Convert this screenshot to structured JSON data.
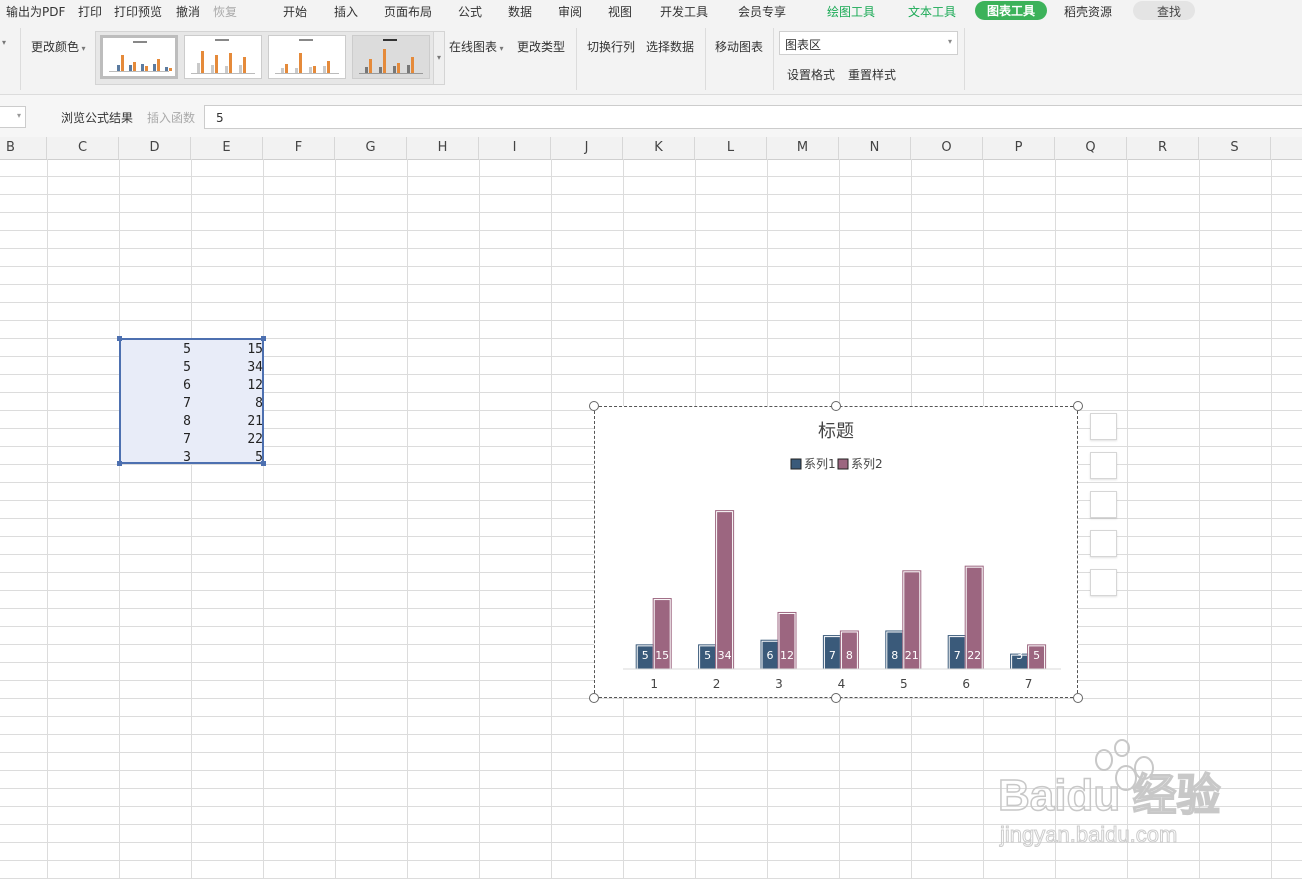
{
  "menu": {
    "items": [
      "输出为PDF",
      "打印",
      "打印预览",
      "撤消",
      "恢复",
      "开始",
      "插入",
      "页面布局",
      "公式",
      "数据",
      "审阅",
      "视图",
      "开发工具",
      "会员专享",
      "绘图工具",
      "文本工具",
      "图表工具",
      "稻壳资源"
    ],
    "search_label": "查找"
  },
  "ribbon": {
    "change_color": "更改颜色",
    "online_chart": "在线图表",
    "change_type": "更改类型",
    "switch_row_col": "切换行列",
    "select_data": "选择数据",
    "move_chart": "移动图表",
    "chart_area_select": "图表区",
    "set_format": "设置格式",
    "reset_style": "重置样式"
  },
  "formula_bar": {
    "browse_result": "浏览公式结果",
    "insert_function": "插入函数",
    "value": "5"
  },
  "columns": [
    "B",
    "C",
    "D",
    "E",
    "F",
    "G",
    "H",
    "I",
    "J",
    "K",
    "L",
    "M",
    "N",
    "O",
    "P",
    "Q",
    "R",
    "S"
  ],
  "selected_range": {
    "col_d": [
      "5",
      "5",
      "6",
      "7",
      "8",
      "7",
      "3"
    ],
    "col_e": [
      "15",
      "34",
      "12",
      "8",
      "21",
      "22",
      "5"
    ]
  },
  "chart_data": {
    "type": "bar",
    "title": "标题",
    "categories": [
      "1",
      "2",
      "3",
      "4",
      "5",
      "6",
      "7"
    ],
    "series": [
      {
        "name": "系列1",
        "values": [
          5,
          5,
          6,
          7,
          8,
          7,
          3
        ],
        "color": "#3a5a7a"
      },
      {
        "name": "系列2",
        "values": [
          15,
          34,
          12,
          8,
          21,
          22,
          5
        ],
        "color": "#9c6680"
      }
    ],
    "legend": "top",
    "data_labels": true,
    "grid": false
  },
  "watermark": {
    "text": "Baidu 经验",
    "url": "jingyan.baidu.com"
  },
  "colors": {
    "accent_green": "#3cb25a",
    "selection_border": "#4d70b0",
    "selection_fill": "#e8ecf8"
  }
}
